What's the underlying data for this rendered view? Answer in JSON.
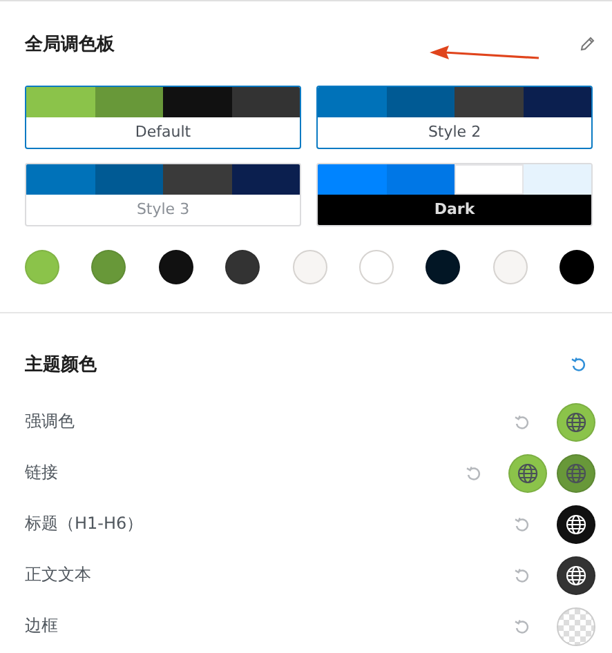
{
  "palette_section": {
    "title": "全局调色板"
  },
  "palettes": [
    {
      "label": "Default",
      "kind": "light",
      "selected": true,
      "colors": [
        {
          "color": "#8bc34a"
        },
        {
          "color": "#689839"
        },
        {
          "color": "#111111"
        },
        {
          "color": "#333333"
        }
      ]
    },
    {
      "label": "Style 2",
      "kind": "light",
      "selected": true,
      "colors": [
        {
          "color": "#0072b9"
        },
        {
          "color": "#005a94"
        },
        {
          "color": "#3a3a3a"
        },
        {
          "color": "#0b1f4f"
        }
      ]
    },
    {
      "label": "Style 3",
      "kind": "light",
      "selected": false,
      "colors": [
        {
          "color": "#0072b9"
        },
        {
          "color": "#005a94"
        },
        {
          "color": "#3a3a3a"
        },
        {
          "color": "#0b1f4f"
        }
      ]
    },
    {
      "label": "Dark",
      "kind": "dark",
      "selected": false,
      "colors": [
        {
          "color": "#0084ff"
        },
        {
          "color": "#0077e6"
        },
        {
          "color": "#ffffff"
        },
        {
          "color": "#e6f3fd"
        }
      ]
    }
  ],
  "swatches": [
    {
      "color": "#8bc34a"
    },
    {
      "color": "#689839"
    },
    {
      "color": "#111111"
    },
    {
      "color": "#333333"
    },
    {
      "color": "#f7f5f3"
    },
    {
      "color": "#ffffff"
    },
    {
      "color": "#021625"
    },
    {
      "color": "#f7f5f3"
    },
    {
      "color": "#000000"
    }
  ],
  "theme_section": {
    "title": "主题颜色"
  },
  "theme_colors": [
    {
      "label": "强调色",
      "swatches": [
        {
          "kind": "color",
          "color": "#8bc34a"
        }
      ]
    },
    {
      "label": "链接",
      "swatches": [
        {
          "kind": "color",
          "color": "#8bc34a"
        },
        {
          "kind": "color",
          "color": "#689839"
        }
      ]
    },
    {
      "label": "标题（H1-H6）",
      "swatches": [
        {
          "kind": "color",
          "color": "#111111"
        }
      ]
    },
    {
      "label": "正文文本",
      "swatches": [
        {
          "kind": "color",
          "color": "#333333"
        }
      ]
    },
    {
      "label": "边框",
      "swatches": [
        {
          "kind": "transparent"
        }
      ]
    }
  ]
}
